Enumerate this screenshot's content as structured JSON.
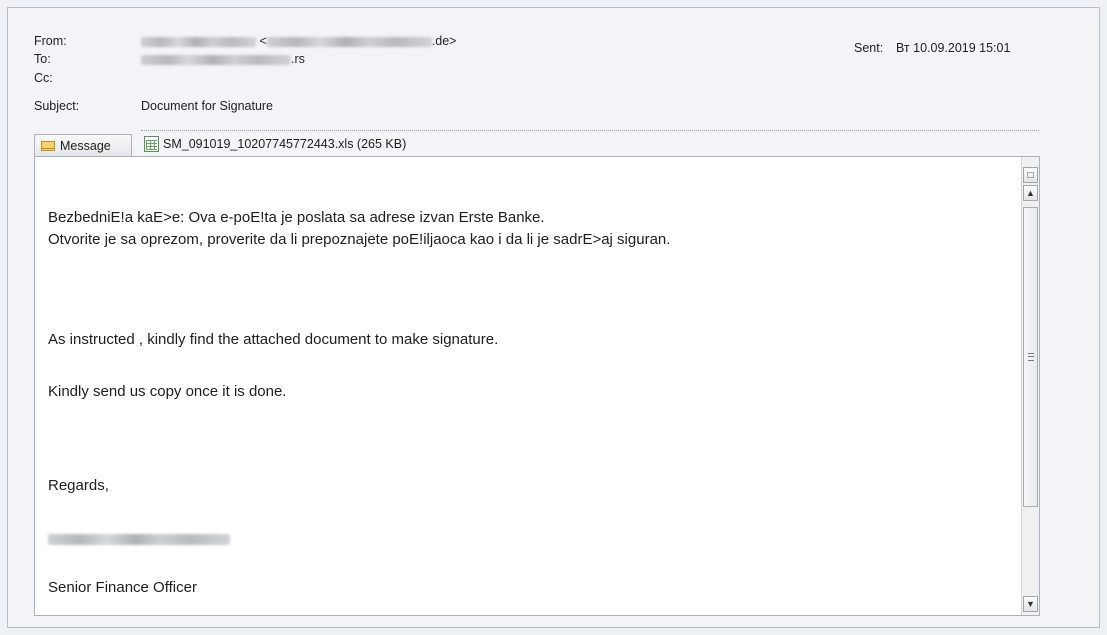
{
  "header": {
    "from_label": "From:",
    "from_value_suffix": ".de>",
    "from_value_prefix": "<",
    "to_label": "To:",
    "to_value_suffix": ".rs",
    "cc_label": "Cc:",
    "subject_label": "Subject:",
    "subject_value": "Document for Signature",
    "sent_label": "Sent:",
    "sent_value": "Вт 10.09.2019 15:01"
  },
  "tabs": {
    "message_label": "Message",
    "message_icon": "envelope-icon",
    "attachment_label": "SM_091019_10207745772443.xls (265 KB)",
    "attachment_icon": "excel-file-icon"
  },
  "body": {
    "line1": "BezbedniE!a kaE>e: Ova e-poE!ta je poslata sa adrese izvan Erste Banke.",
    "line2": "Otvorite je sa oprezom, proverite da li prepoznajete poE!iljaoca kao i da li je sadrE>aj siguran.",
    "line3": "As instructed , kindly find the attached document to make signature.",
    "line4": "Kindly send us copy once it is done.",
    "line5": "Regards,",
    "line6": "Senior Finance Officer"
  },
  "scrollbar": {
    "up_icon": "chevron-up-icon",
    "down_icon": "chevron-down-icon",
    "grip_icon": "grip-icon",
    "corner_icon": "page-corner-icon"
  }
}
